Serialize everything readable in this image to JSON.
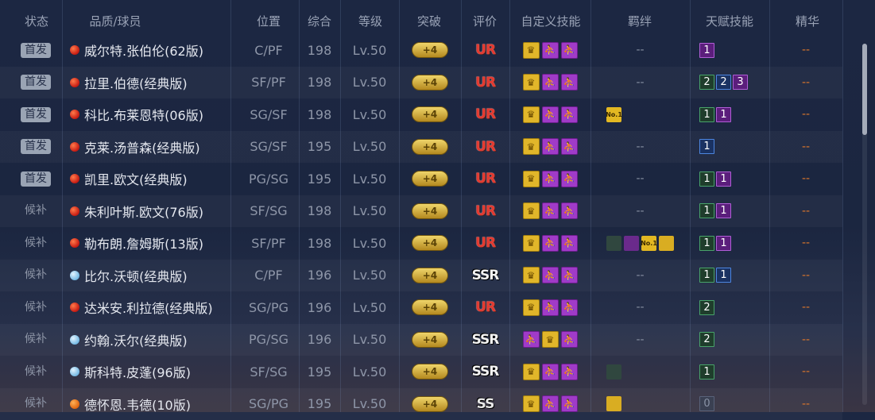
{
  "headers": [
    "状态",
    "品质/球员",
    "位置",
    "综合",
    "等级",
    "突破",
    "评价",
    "自定义技能",
    "羁绊",
    "天赋技能",
    "精华"
  ],
  "rows": [
    {
      "status": "首发",
      "status_type": "starter",
      "quality": "red",
      "name": "威尔特.张伯伦(62版)",
      "position": "C/PF",
      "overall": "198",
      "level": "Lv.50",
      "breakthrough": "+4",
      "rating": "UR",
      "skills": [
        "gold",
        "purple",
        "purple"
      ],
      "bonds": [],
      "bonds_text": "--",
      "talents": [
        {
          "value": "1",
          "color": "purple"
        }
      ],
      "essence": "--"
    },
    {
      "status": "首发",
      "status_type": "starter",
      "quality": "red",
      "name": "拉里.伯德(经典版)",
      "position": "SF/PF",
      "overall": "198",
      "level": "Lv.50",
      "breakthrough": "+4",
      "rating": "UR",
      "skills": [
        "gold",
        "purple",
        "purple"
      ],
      "bonds": [],
      "bonds_text": "--",
      "talents": [
        {
          "value": "2",
          "color": "green"
        },
        {
          "value": "2",
          "color": "blue"
        },
        {
          "value": "3",
          "color": "purple"
        }
      ],
      "essence": "--"
    },
    {
      "status": "首发",
      "status_type": "starter",
      "quality": "red",
      "name": "科比.布莱恩特(06版)",
      "position": "SG/SF",
      "overall": "198",
      "level": "Lv.50",
      "breakthrough": "+4",
      "rating": "UR",
      "skills": [
        "gold",
        "purple",
        "purple"
      ],
      "bonds": [
        {
          "type": "no1",
          "label": "No.1"
        }
      ],
      "bonds_text": "",
      "talents": [
        {
          "value": "1",
          "color": "green"
        },
        {
          "value": "1",
          "color": "purple"
        }
      ],
      "essence": "--"
    },
    {
      "status": "首发",
      "status_type": "starter",
      "quality": "red",
      "name": "克莱.汤普森(经典版)",
      "position": "SG/SF",
      "overall": "195",
      "level": "Lv.50",
      "breakthrough": "+4",
      "rating": "UR",
      "skills": [
        "gold",
        "purple",
        "purple"
      ],
      "bonds": [],
      "bonds_text": "--",
      "talents": [
        {
          "value": "1",
          "color": "blue"
        }
      ],
      "essence": "--"
    },
    {
      "status": "首发",
      "status_type": "starter",
      "quality": "red",
      "name": "凯里.欧文(经典版)",
      "position": "PG/SG",
      "overall": "195",
      "level": "Lv.50",
      "breakthrough": "+4",
      "rating": "UR",
      "skills": [
        "gold",
        "purple",
        "purple"
      ],
      "bonds": [],
      "bonds_text": "--",
      "talents": [
        {
          "value": "1",
          "color": "green"
        },
        {
          "value": "1",
          "color": "purple"
        }
      ],
      "essence": "--"
    },
    {
      "status": "候补",
      "status_type": "bench",
      "quality": "red",
      "name": "朱利叶斯.欧文(76版)",
      "position": "SF/SG",
      "overall": "198",
      "level": "Lv.50",
      "breakthrough": "+4",
      "rating": "UR",
      "skills": [
        "gold",
        "purple",
        "purple"
      ],
      "bonds": [],
      "bonds_text": "--",
      "talents": [
        {
          "value": "1",
          "color": "green"
        },
        {
          "value": "1",
          "color": "purple"
        }
      ],
      "essence": "--"
    },
    {
      "status": "候补",
      "status_type": "bench",
      "quality": "red",
      "name": "勒布朗.詹姆斯(13版)",
      "position": "SF/PF",
      "overall": "198",
      "level": "Lv.50",
      "breakthrough": "+4",
      "rating": "UR",
      "skills": [
        "gold",
        "purple",
        "purple"
      ],
      "bonds": [
        {
          "type": "crest",
          "label": ""
        },
        {
          "type": "purple",
          "label": ""
        },
        {
          "type": "no1",
          "label": "No.1"
        },
        {
          "type": "gold",
          "label": ""
        }
      ],
      "bonds_text": "",
      "talents": [
        {
          "value": "1",
          "color": "green"
        },
        {
          "value": "1",
          "color": "purple"
        }
      ],
      "essence": "--"
    },
    {
      "status": "候补",
      "status_type": "bench",
      "quality": "blue",
      "name": "比尔.沃顿(经典版)",
      "position": "C/PF",
      "overall": "196",
      "level": "Lv.50",
      "breakthrough": "+4",
      "rating": "SSR",
      "skills": [
        "gold",
        "purple",
        "purple"
      ],
      "bonds": [],
      "bonds_text": "--",
      "talents": [
        {
          "value": "1",
          "color": "green"
        },
        {
          "value": "1",
          "color": "blue"
        }
      ],
      "essence": "--"
    },
    {
      "status": "候补",
      "status_type": "bench",
      "quality": "red",
      "name": "达米安.利拉德(经典版)",
      "position": "SG/PG",
      "overall": "196",
      "level": "Lv.50",
      "breakthrough": "+4",
      "rating": "UR",
      "skills": [
        "gold",
        "purple",
        "purple"
      ],
      "bonds": [],
      "bonds_text": "--",
      "talents": [
        {
          "value": "2",
          "color": "green"
        }
      ],
      "essence": "--"
    },
    {
      "status": "候补",
      "status_type": "bench",
      "quality": "blue",
      "name": "约翰.沃尔(经典版)",
      "position": "PG/SG",
      "overall": "196",
      "level": "Lv.50",
      "breakthrough": "+4",
      "rating": "SSR",
      "skills": [
        "purple",
        "gold",
        "purple"
      ],
      "bonds": [],
      "bonds_text": "--",
      "talents": [
        {
          "value": "2",
          "color": "green"
        }
      ],
      "essence": "--"
    },
    {
      "status": "候补",
      "status_type": "bench",
      "quality": "blue",
      "name": "斯科特.皮蓬(96版)",
      "position": "SF/SG",
      "overall": "195",
      "level": "Lv.50",
      "breakthrough": "+4",
      "rating": "SSR",
      "skills": [
        "gold",
        "purple",
        "purple"
      ],
      "bonds": [
        {
          "type": "crest",
          "label": ""
        }
      ],
      "bonds_text": "",
      "talents": [
        {
          "value": "1",
          "color": "green"
        }
      ],
      "essence": "--"
    },
    {
      "status": "候补",
      "status_type": "bench",
      "quality": "orange",
      "name": "德怀恩.韦德(10版)",
      "position": "SG/PG",
      "overall": "195",
      "level": "Lv.50",
      "breakthrough": "+4",
      "rating": "SS",
      "skills": [
        "gold",
        "purple",
        "purple"
      ],
      "bonds": [
        {
          "type": "gold",
          "label": ""
        }
      ],
      "bonds_text": "",
      "talents": [
        {
          "value": "0",
          "color": "gray"
        }
      ],
      "essence": "--"
    }
  ],
  "colors": {
    "rating_ur": "#e5392f",
    "rating_ssr": "#f3f3f3",
    "essence_dash": "#e0782a",
    "starter_badge": "#9aa4b4"
  },
  "icons": {
    "skill_gold": "crown-icon",
    "skill_purple": "player-silhouette-icon",
    "bond_no1": "no1-badge-icon",
    "bond_crest": "team-crest-icon"
  }
}
